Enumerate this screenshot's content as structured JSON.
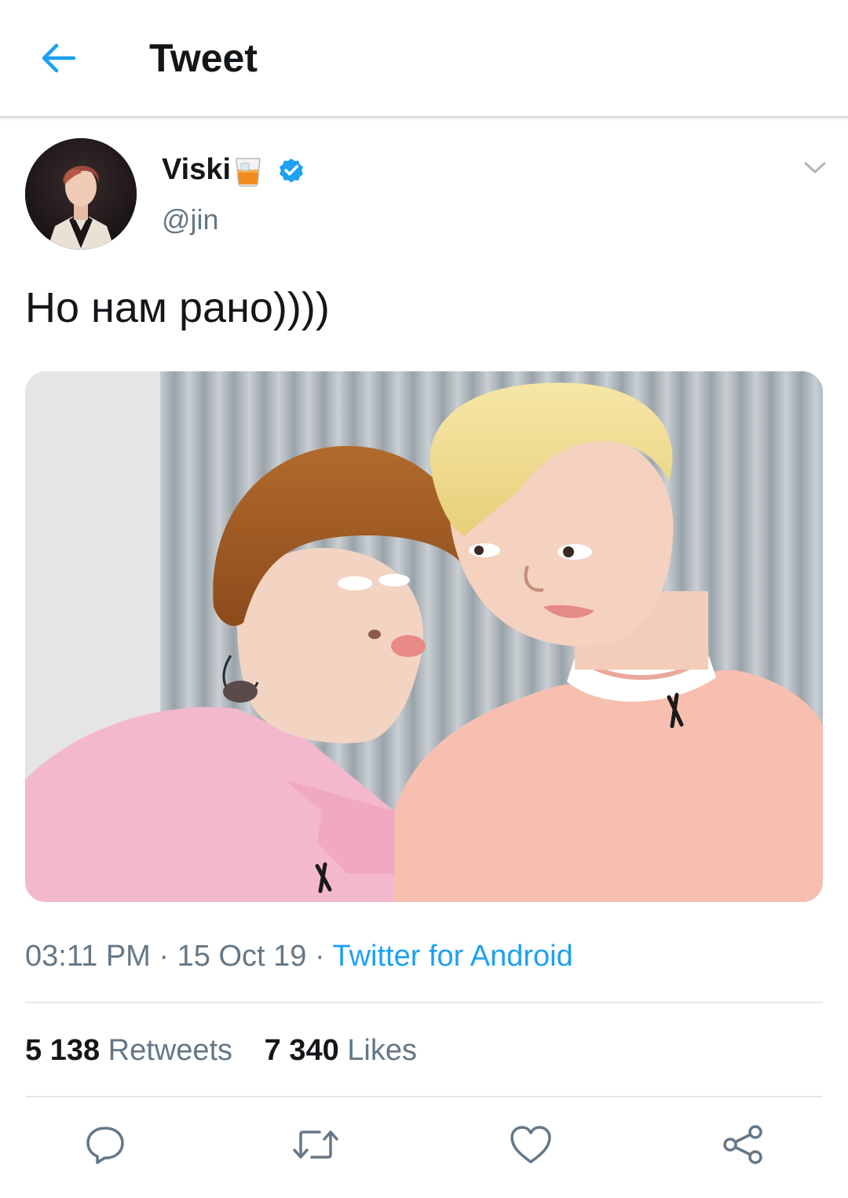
{
  "header": {
    "title": "Tweet",
    "back_icon": "arrow-left-icon",
    "accent": "#1da1f2"
  },
  "author": {
    "display_name": "Viski",
    "name_emoji": "whiskey-glass-emoji",
    "verified_icon": "verified-badge-icon",
    "handle": "@jin"
  },
  "tweet": {
    "text": "Но нам рано))))",
    "time": "03:11 PM",
    "separator": "·",
    "date": "15 Oct 19",
    "source": "Twitter for Android"
  },
  "stats": {
    "retweets_count": "5 138",
    "retweets_label": "Retweets",
    "likes_count": "7 340",
    "likes_label": "Likes"
  },
  "actions": {
    "reply_icon": "reply-icon",
    "retweet_icon": "retweet-icon",
    "like_icon": "heart-icon",
    "share_icon": "share-icon"
  },
  "colors": {
    "text_primary": "#14171a",
    "text_secondary": "#657786",
    "link": "#1da1f2",
    "divider": "#e1e8ed"
  }
}
